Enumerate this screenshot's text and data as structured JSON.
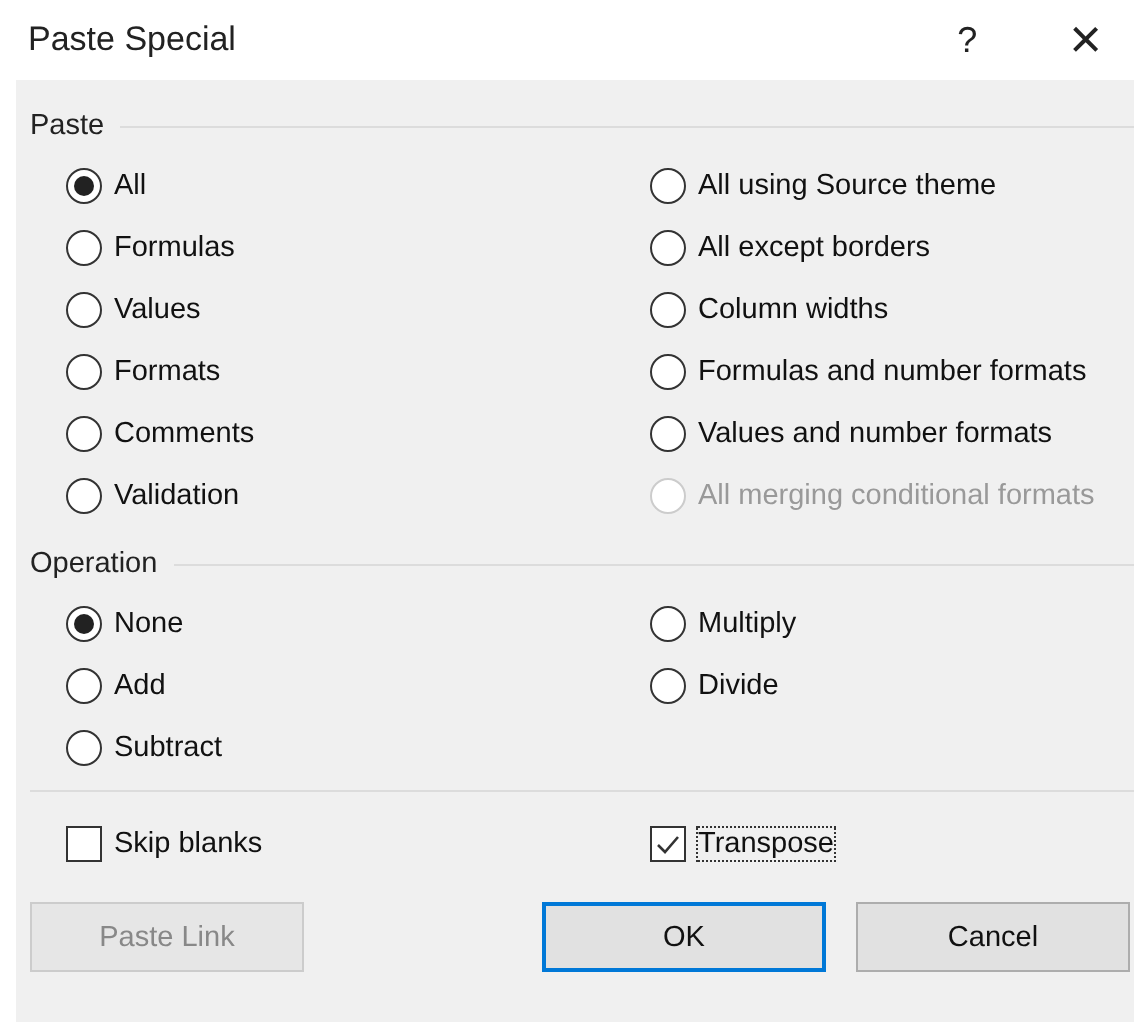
{
  "window": {
    "title": "Paste Special",
    "help": "?",
    "close": "×"
  },
  "paste": {
    "label": "Paste",
    "options": [
      {
        "label": "All",
        "selected": true,
        "disabled": false
      },
      {
        "label": "All using Source theme",
        "selected": false,
        "disabled": false
      },
      {
        "label": "Formulas",
        "selected": false,
        "disabled": false
      },
      {
        "label": "All except borders",
        "selected": false,
        "disabled": false
      },
      {
        "label": "Values",
        "selected": false,
        "disabled": false
      },
      {
        "label": "Column widths",
        "selected": false,
        "disabled": false
      },
      {
        "label": "Formats",
        "selected": false,
        "disabled": false
      },
      {
        "label": "Formulas and number formats",
        "selected": false,
        "disabled": false
      },
      {
        "label": "Comments",
        "selected": false,
        "disabled": false
      },
      {
        "label": "Values and number formats",
        "selected": false,
        "disabled": false
      },
      {
        "label": "Validation",
        "selected": false,
        "disabled": false
      },
      {
        "label": "All merging conditional formats",
        "selected": false,
        "disabled": true
      }
    ]
  },
  "operation": {
    "label": "Operation",
    "options": [
      {
        "label": "None",
        "selected": true,
        "disabled": false
      },
      {
        "label": "Multiply",
        "selected": false,
        "disabled": false
      },
      {
        "label": "Add",
        "selected": false,
        "disabled": false
      },
      {
        "label": "Divide",
        "selected": false,
        "disabled": false
      },
      {
        "label": "Subtract",
        "selected": false,
        "disabled": false
      }
    ]
  },
  "checkboxes": [
    {
      "label": "Skip blanks",
      "checked": false,
      "focused": false
    },
    {
      "label": "Transpose",
      "checked": true,
      "focused": true
    }
  ],
  "buttons": [
    {
      "label": "Paste Link",
      "disabled": true,
      "default": false
    },
    {
      "label": "OK",
      "disabled": false,
      "default": true
    },
    {
      "label": "Cancel",
      "disabled": false,
      "default": false
    }
  ]
}
